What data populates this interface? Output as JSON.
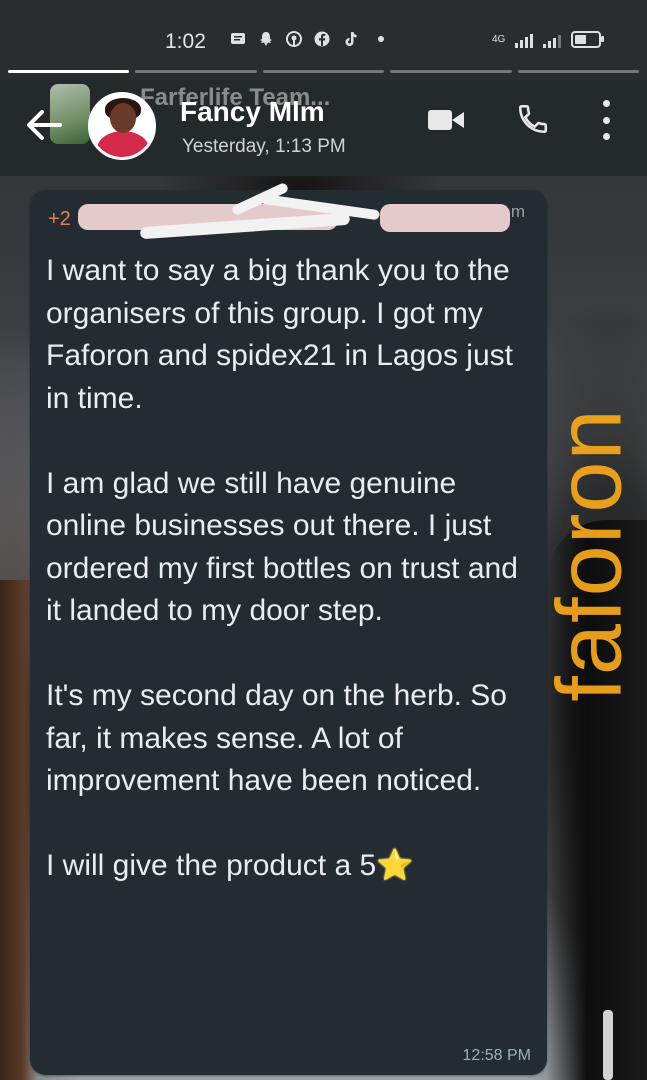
{
  "status_bar": {
    "time": "1:02",
    "icons": [
      "messages-icon",
      "snapchat-icon",
      "pinterest-icon",
      "facebook-icon",
      "tiktok-icon",
      "dot-icon"
    ],
    "network_label": "4G",
    "battery_level": 0.55
  },
  "story": {
    "segment_count": 5,
    "active_index": 0
  },
  "header": {
    "group_name": "Farferlife Team...",
    "contact_name": "Fancy Mlm",
    "last_seen": "Yesterday, 1:13 PM",
    "colors": {
      "header_bg": "#24292c"
    }
  },
  "message": {
    "sender_prefix": "+2",
    "sender_suffix": "m",
    "body": "I want to say a big thank you to the organisers of this group. I got my Faforon and spidex21 in Lagos just in time.\n\nI am glad we still have genuine online businesses out there. I just ordered my first bottles on trust and it landed to my door step.\n\nIt's my second day on the herb. So far, it makes sense. A lot of improvement have been noticed.\n\nI will give the product a 5",
    "emoji": "⭐",
    "time": "12:58 PM",
    "colors": {
      "bubble_bg": "#222c31",
      "text": "#e9edef",
      "sender": "#e67e5b"
    }
  },
  "watermark": {
    "text": "faforon",
    "color": "#f7a81b"
  }
}
